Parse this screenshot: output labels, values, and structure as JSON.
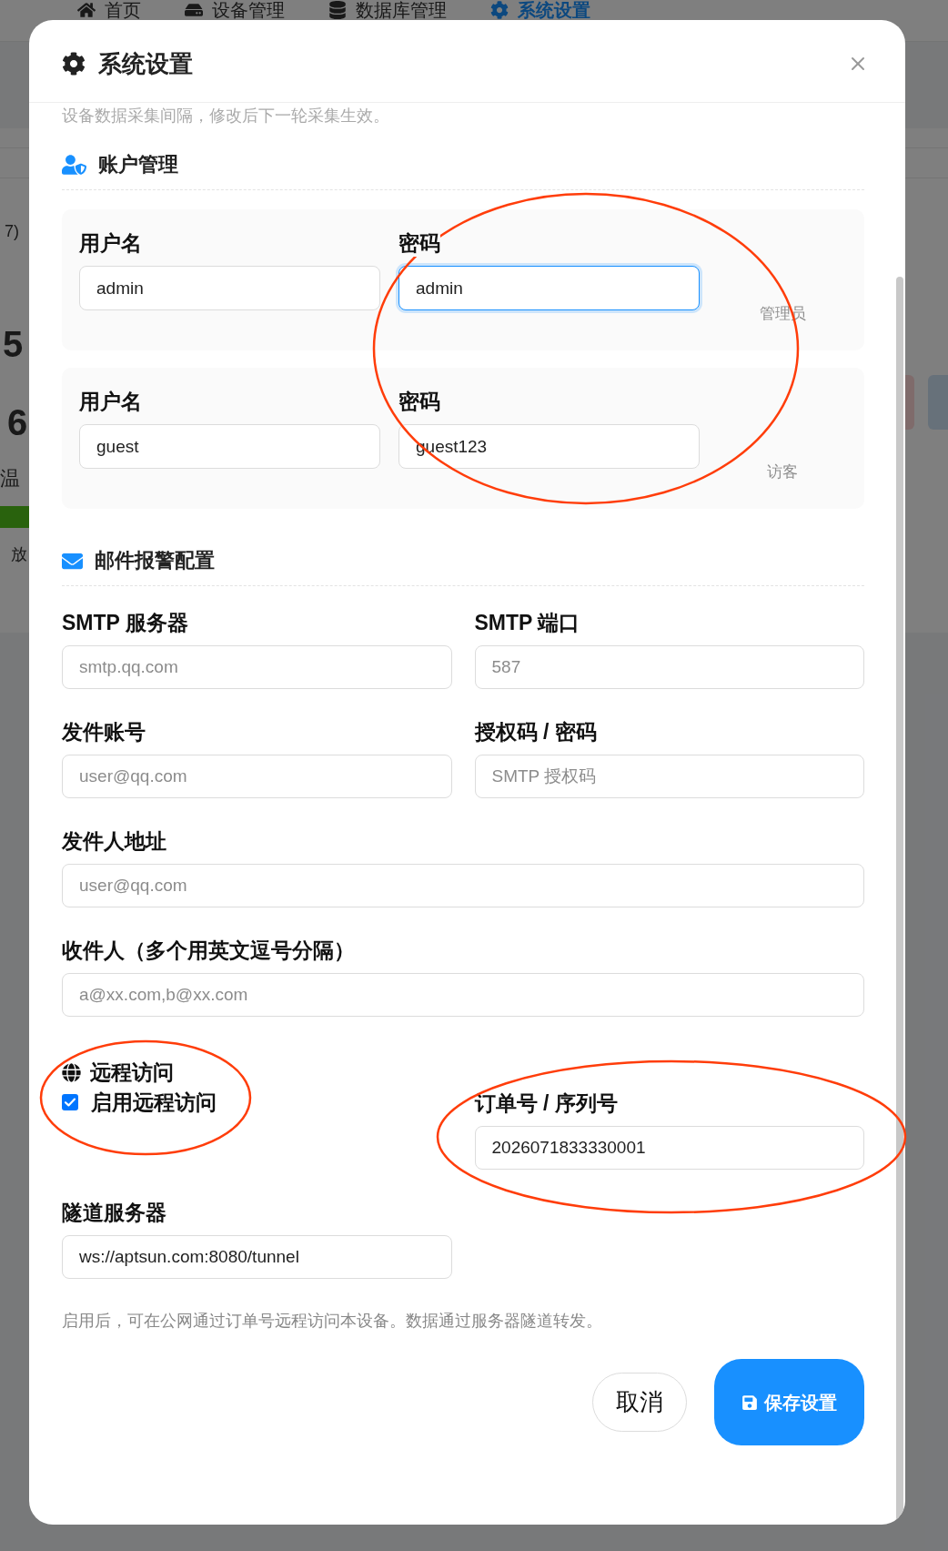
{
  "background": {
    "nav": [
      {
        "label": "首页",
        "selected": false
      },
      {
        "label": "设备管理",
        "selected": false
      },
      {
        "label": "数据库管理",
        "selected": false
      },
      {
        "label": "系统设置",
        "selected": true
      }
    ],
    "side_texts": [
      {
        "text": "7)",
        "kind": "caption"
      },
      {
        "text": "5",
        "kind": "figure"
      },
      {
        "text": "6",
        "kind": "figure"
      },
      {
        "text": "温",
        "kind": "label"
      },
      {
        "text": "放",
        "kind": "note"
      }
    ]
  },
  "dialog": {
    "title": "系统设置",
    "scrolled_text": "设备数据采集间隔，修改后下一轮采集生效。",
    "accounts": {
      "title": "账户管理",
      "rows": [
        {
          "fields": [
            {
              "label": "用户名",
              "value": "admin",
              "focused": false
            },
            {
              "label": "密码",
              "value": "admin",
              "focused": true
            }
          ],
          "role": "管理员"
        },
        {
          "fields": [
            {
              "label": "用户名",
              "value": "guest",
              "focused": false
            },
            {
              "label": "密码",
              "value": "guest123",
              "focused": false
            }
          ],
          "role": "访客"
        }
      ]
    },
    "email": {
      "title": "邮件报警配置",
      "rows": [
        [
          {
            "label": "SMTP 服务器",
            "placeholder": "smtp.qq.com"
          },
          {
            "label": "SMTP 端口",
            "placeholder": "587"
          }
        ],
        [
          {
            "label": "发件账号",
            "placeholder": "user@qq.com"
          },
          {
            "label": "授权码 / 密码",
            "placeholder": "SMTP 授权码"
          }
        ],
        [
          {
            "label": "发件人地址",
            "placeholder": "user@qq.com"
          }
        ],
        [
          {
            "label": "收件人（多个用英文逗号分隔）",
            "placeholder": "a@xx.com,b@xx.com"
          }
        ]
      ]
    },
    "remote": {
      "title": "远程访问",
      "enable_label": "启用远程访问",
      "enabled": true,
      "order": {
        "label": "订单号 / 序列号",
        "value": "2026071833330001"
      },
      "tunnel": {
        "label": "隧道服务器",
        "value": "ws://aptsun.com:8080/tunnel"
      },
      "hint": "启用后，可在公网通过订单号远程访问本设备。数据通过服务器隧道转发。"
    },
    "buttons": [
      {
        "label": "取消",
        "kind": "secondary"
      },
      {
        "label": "保存设置",
        "kind": "primary"
      }
    ]
  }
}
